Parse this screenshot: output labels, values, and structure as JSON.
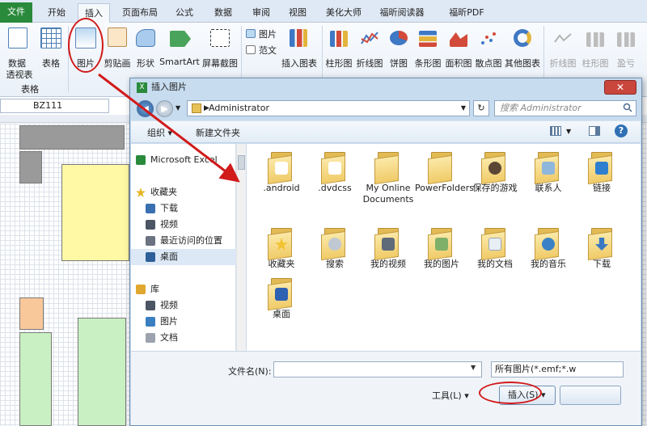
{
  "ribbon": {
    "tabs": [
      {
        "id": "file",
        "label": "文件"
      },
      {
        "id": "home",
        "label": "开始"
      },
      {
        "id": "insert",
        "label": "插入"
      },
      {
        "id": "layout",
        "label": "页面布局"
      },
      {
        "id": "formula",
        "label": "公式"
      },
      {
        "id": "data",
        "label": "数据"
      },
      {
        "id": "review",
        "label": "审阅"
      },
      {
        "id": "view",
        "label": "视图"
      },
      {
        "id": "meihua",
        "label": "美化大师"
      },
      {
        "id": "reader",
        "label": "福昕阅读器"
      },
      {
        "id": "pdf",
        "label": "福昕PDF"
      }
    ],
    "pivot_label_1": "数据",
    "pivot_label_2": "透视表",
    "table_label": "表格",
    "group_table": "表格",
    "picture_label": "图片",
    "clipart_label": "剪贴画",
    "shapes_label": "形状",
    "smartart_label": "SmartArt",
    "screenshot_label": "屏幕截图",
    "small_picture": "图片",
    "small_text": "范文",
    "insert_chart_label": "插入图表",
    "charts": [
      "柱形图",
      "折线图",
      "饼图",
      "条形图",
      "面积图",
      "散点图",
      "其他图表"
    ],
    "sparklines": [
      "折线图",
      "柱形图",
      "盈亏"
    ]
  },
  "namebox": "BZ111",
  "dialog": {
    "title": "插入图片",
    "close": "✕",
    "address": "Administrator",
    "search_placeholder": "搜索 Administrator",
    "organize": "组织 ▾",
    "new_folder": "新建文件夹",
    "nav": [
      {
        "label": "Microsoft Excel",
        "color": "#2a8a3b"
      },
      {
        "label": "收藏夹",
        "color": "#e6b422"
      },
      {
        "label": "下载",
        "color": "#3a6fb0"
      },
      {
        "label": "视频",
        "color": "#4b5563"
      },
      {
        "label": "最近访问的位置",
        "color": "#6b7280"
      },
      {
        "label": "桌面",
        "color": "#2f5f99"
      },
      {
        "label": "库",
        "color": "#e0a82e"
      },
      {
        "label": "视频",
        "color": "#4b5563"
      },
      {
        "label": "图片",
        "color": "#3a7fc0"
      },
      {
        "label": "文档",
        "color": "#9ca3af"
      }
    ],
    "files": [
      {
        "label": ".android",
        "deco": "#ffffff"
      },
      {
        "label": ".dvdcss",
        "deco": "#ffffff"
      },
      {
        "label": "My Online Documents",
        "deco": "#f5d77a"
      },
      {
        "label": "PowerFolders",
        "deco": "#f5d77a"
      },
      {
        "label": "保存的游戏",
        "deco": "#5b4636"
      },
      {
        "label": "联系人",
        "deco": "#8fb7dc"
      },
      {
        "label": "链接",
        "deco": "#2f7fd0"
      },
      {
        "label": "收藏夹",
        "deco": "#f2c230"
      },
      {
        "label": "搜索",
        "deco": "#c0c8d2"
      },
      {
        "label": "我的视频",
        "deco": "#5f6b78"
      },
      {
        "label": "我的图片",
        "deco": "#7fb06a"
      },
      {
        "label": "我的文档",
        "deco": "#e9eef5"
      },
      {
        "label": "我的音乐",
        "deco": "#3b82c4"
      },
      {
        "label": "下载",
        "deco": "#3a78c2"
      },
      {
        "label": "桌面",
        "deco": "#2d62b2"
      }
    ],
    "filename_label": "文件名(N):",
    "filetype": "所有图片(*.emf;*.w",
    "tools": "工具(L) ▾",
    "insert": "插入(S) ▾"
  }
}
